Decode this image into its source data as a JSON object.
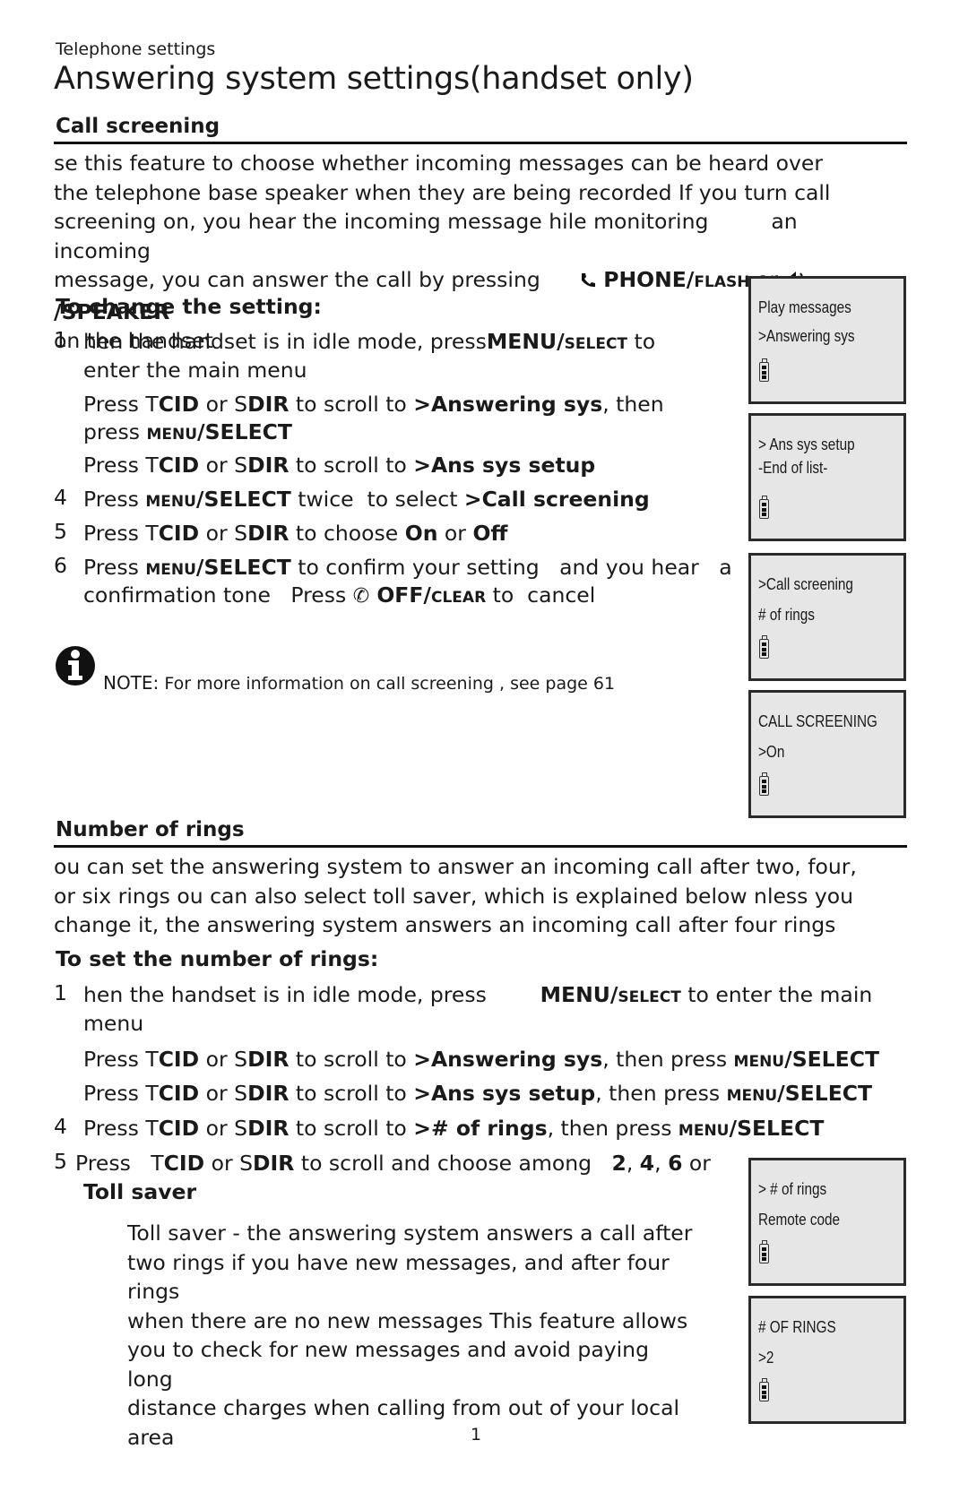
{
  "page": {
    "breadcrumb": "Telephone settings",
    "title": "Answering system settings(handset only)",
    "page_number": "1"
  },
  "call_screening": {
    "heading": "Call screening",
    "intro": {
      "line1": "se this feature to choose whether incoming messages can be heard over",
      "line2": "the telephone base speaker when they are being recorded If you turn call",
      "line3a": "screening on, you hear the incoming message hile monitoring",
      "line3b": "an incoming",
      "line4a": "message, you can answer the call by pressing",
      "phone_key": "PHONE/",
      "phone_key_sc": "FLASH",
      "or": "or",
      "speaker_key": "/SPEAKER",
      "line5": "on the handset"
    },
    "subheading": "To change the setting:",
    "steps": [
      {
        "num": "1",
        "parts": [
          {
            "t": "hen the handset is in idle mode, press"
          },
          {
            "t": "MENU/",
            "b": true
          },
          {
            "t": "SELECT",
            "sc": true
          },
          {
            "t": " to"
          }
        ],
        "cont": "enter the main menu"
      },
      {
        "num": "",
        "parts": [
          {
            "t": "Press "
          },
          {
            "t": "T"
          },
          {
            "t": "CID",
            "b": true
          },
          {
            "t": " or "
          },
          {
            "t": "S"
          },
          {
            "t": "DIR",
            "b": true
          },
          {
            "t": " to scroll to "
          },
          {
            "t": ">Answering sys",
            "b": true
          },
          {
            "t": ", then"
          }
        ],
        "cont_parts": [
          {
            "t": "press "
          },
          {
            "t": "MENU",
            "sc": true
          },
          {
            "t": "/SELECT",
            "b": true
          }
        ]
      },
      {
        "num": "",
        "parts": [
          {
            "t": "Press "
          },
          {
            "t": "T"
          },
          {
            "t": "CID",
            "b": true
          },
          {
            "t": " or "
          },
          {
            "t": "S"
          },
          {
            "t": "DIR",
            "b": true
          },
          {
            "t": " to scroll to "
          },
          {
            "t": ">Ans sys setup",
            "b": true
          }
        ]
      },
      {
        "num": "4",
        "parts": [
          {
            "t": "Press "
          },
          {
            "t": "MENU",
            "sc": true
          },
          {
            "t": "/SELECT",
            "b": true
          },
          {
            "t": " twice  to select "
          },
          {
            "t": ">Call screening",
            "b": true
          }
        ]
      },
      {
        "num": "5",
        "parts": [
          {
            "t": "Press "
          },
          {
            "t": "T"
          },
          {
            "t": "CID",
            "b": true
          },
          {
            "t": " or "
          },
          {
            "t": "S"
          },
          {
            "t": "DIR",
            "b": true
          },
          {
            "t": " to choose "
          },
          {
            "t": "On",
            "b": true
          },
          {
            "t": " or "
          },
          {
            "t": "Off",
            "b": true
          }
        ]
      },
      {
        "num": "6",
        "parts": [
          {
            "t": "Press "
          },
          {
            "t": "MENU",
            "sc": true
          },
          {
            "t": "/SELECT",
            "b": true
          },
          {
            "t": " to confirm your setting   and you hear   a"
          }
        ],
        "cont_parts": [
          {
            "t": "confirmation tone   Press "
          },
          {
            "t": "✆",
            "icon": "off-clear-icon"
          },
          {
            "t": " OFF/",
            "b": true
          },
          {
            "t": "CLEAR",
            "sc": true
          },
          {
            "t": " to  cancel"
          }
        ]
      }
    ],
    "note_label": "NOTE:",
    "note_text": " For more information on call screening    , see  page 61"
  },
  "number_of_rings": {
    "heading": "Number of rings",
    "intro": {
      "line1": "ou can set the answering system to answer an incoming call after two, four,",
      "line2": "or six rings ou can also select toll saver, which is explained below nless you",
      "line3": "change it, the answering system answers an incoming call after four rings"
    },
    "subheading": "To set the number of rings:",
    "steps": [
      {
        "num": "1",
        "parts": [
          {
            "t": "hen the handset is in idle mode, press        "
          },
          {
            "t": "MENU/",
            "b": true
          },
          {
            "t": "SELECT",
            "sc": true
          },
          {
            "t": " to enter the main"
          }
        ],
        "cont": "menu"
      },
      {
        "num": "",
        "parts": [
          {
            "t": "Press "
          },
          {
            "t": "T"
          },
          {
            "t": "CID",
            "b": true
          },
          {
            "t": " or "
          },
          {
            "t": "S"
          },
          {
            "t": "DIR",
            "b": true
          },
          {
            "t": " to scroll to "
          },
          {
            "t": ">Answering sys",
            "b": true
          },
          {
            "t": ", then press "
          },
          {
            "t": "MENU",
            "sc": true
          },
          {
            "t": "/SELECT",
            "b": true
          }
        ]
      },
      {
        "num": "",
        "parts": [
          {
            "t": "Press "
          },
          {
            "t": "T"
          },
          {
            "t": "CID",
            "b": true
          },
          {
            "t": " or "
          },
          {
            "t": "S"
          },
          {
            "t": "DIR",
            "b": true
          },
          {
            "t": " to scroll to "
          },
          {
            "t": ">Ans sys setup",
            "b": true
          },
          {
            "t": ", then press "
          },
          {
            "t": "MENU",
            "sc": true
          },
          {
            "t": "/SELECT",
            "b": true
          }
        ]
      },
      {
        "num": "4",
        "parts": [
          {
            "t": "Press "
          },
          {
            "t": "T"
          },
          {
            "t": "CID",
            "b": true
          },
          {
            "t": " or "
          },
          {
            "t": "S"
          },
          {
            "t": "DIR",
            "b": true
          },
          {
            "t": " to scroll to "
          },
          {
            "t": "># of rings",
            "b": true
          },
          {
            "t": ", then press "
          },
          {
            "t": "MENU",
            "sc": true
          },
          {
            "t": "/SELECT",
            "b": true
          }
        ]
      },
      {
        "num": "5",
        "parts": [
          {
            "t": "Press   "
          },
          {
            "t": "T"
          },
          {
            "t": "CID",
            "b": true
          },
          {
            "t": " or "
          },
          {
            "t": "S"
          },
          {
            "t": "DIR",
            "b": true
          },
          {
            "t": " to scroll and choose among   "
          },
          {
            "t": "2",
            "b": true
          },
          {
            "t": ", "
          },
          {
            "t": "4",
            "b": true
          },
          {
            "t": ", "
          },
          {
            "t": "6",
            "b": true
          },
          {
            "t": " or"
          }
        ],
        "cont_parts": [
          {
            "t": "Toll saver",
            "b": true
          }
        ]
      }
    ],
    "toll_saver": [
      "Toll saver - the answering system answers a call after",
      "two rings if you have new messages, and after four rings",
      "when there are no new messages This feature allows",
      "you to check for new messages and avoid paying long",
      "distance charges when calling from out of your local",
      "area"
    ]
  },
  "screens": [
    {
      "line1": " Play messages",
      "line2": ">Answering sys"
    },
    {
      "line1": "> Ans sys setup",
      "line2": "-End of list-"
    },
    {
      "line1": ">Call screening",
      "line2": "  # of rings"
    },
    {
      "line1": "CALL SCREENING",
      "line2": ">On"
    },
    {
      "line1": "> # of rings",
      "line2": "  Remote code"
    },
    {
      "line1": "# OF RINGS",
      "line2": ">2"
    }
  ]
}
